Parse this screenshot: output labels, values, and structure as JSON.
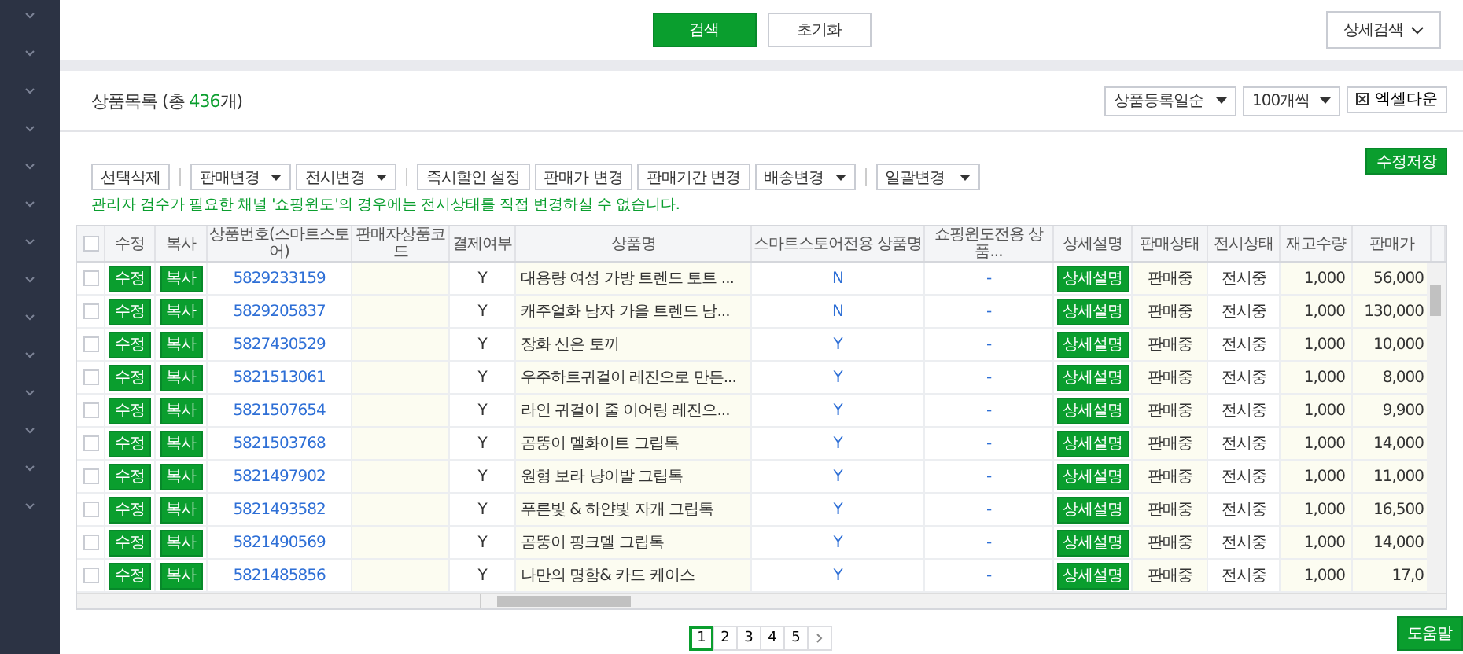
{
  "search_bar": {
    "search": "검색",
    "reset": "초기화",
    "detail_search": "상세검색"
  },
  "list": {
    "title": "상품목록 (총 ",
    "count": "436",
    "title_end": "개)",
    "sort": "상품등록일순",
    "page_size": "100개씩",
    "excel": "엑셀다운"
  },
  "toolbar": {
    "groups": [
      [
        {
          "kind": "button",
          "label": "선택삭제"
        }
      ],
      [
        {
          "kind": "dropdown",
          "label": "판매변경"
        },
        {
          "kind": "dropdown",
          "label": "전시변경"
        }
      ],
      [
        {
          "kind": "button",
          "label": "즉시할인 설정"
        },
        {
          "kind": "button",
          "label": "판매가 변경"
        },
        {
          "kind": "button",
          "label": "판매기간 변경"
        },
        {
          "kind": "dropdown",
          "label": "배송변경"
        }
      ],
      [
        {
          "kind": "wide_dropdown",
          "label": "일괄변경"
        }
      ]
    ],
    "save": "수정저장",
    "notice": "관리자 검수가 필요한 채널 '쇼핑윈도'의 경우에는 전시상태를 직접 변경하실 수 없습니다."
  },
  "table": {
    "all_checked": false,
    "columns": [
      "수정",
      "복사",
      "상품번호(스마트스토어)",
      "판매자상품코드",
      "결제여부",
      "상품명",
      "스마트스토어전용 상품명",
      "쇼핑윈도전용 상품...",
      "상세설명",
      "판매상태",
      "전시상태",
      "재고수량",
      "판매가"
    ],
    "rows": [
      {
        "checked": false,
        "edit": "수정",
        "copy": "복사",
        "product_no": "5829233159",
        "payment": "Y",
        "name": "대용량 여성 가방 트렌드 토트 ...",
        "smartstore_name": "N",
        "window_name": "-",
        "detail": "상세설명",
        "sale_status": "판매중",
        "display_status": "전시중",
        "stock": "1,000",
        "price": "56,000"
      },
      {
        "checked": false,
        "edit": "수정",
        "copy": "복사",
        "product_no": "5829205837",
        "payment": "Y",
        "name": "캐주얼화 남자 가을 트렌드 남...",
        "smartstore_name": "N",
        "window_name": "-",
        "detail": "상세설명",
        "sale_status": "판매중",
        "display_status": "전시중",
        "stock": "1,000",
        "price": "130,000"
      },
      {
        "checked": false,
        "edit": "수정",
        "copy": "복사",
        "product_no": "5827430529",
        "payment": "Y",
        "name": "장화 신은 토끼",
        "smartstore_name": "Y",
        "window_name": "-",
        "detail": "상세설명",
        "sale_status": "판매중",
        "display_status": "전시중",
        "stock": "1,000",
        "price": "10,000"
      },
      {
        "checked": false,
        "edit": "수정",
        "copy": "복사",
        "product_no": "5821513061",
        "payment": "Y",
        "name": "우주하트귀걸이 레진으로 만든...",
        "smartstore_name": "Y",
        "window_name": "-",
        "detail": "상세설명",
        "sale_status": "판매중",
        "display_status": "전시중",
        "stock": "1,000",
        "price": "8,000"
      },
      {
        "checked": false,
        "edit": "수정",
        "copy": "복사",
        "product_no": "5821507654",
        "payment": "Y",
        "name": "라인 귀걸이 줄 이어링 레진으...",
        "smartstore_name": "Y",
        "window_name": "-",
        "detail": "상세설명",
        "sale_status": "판매중",
        "display_status": "전시중",
        "stock": "1,000",
        "price": "9,900"
      },
      {
        "checked": false,
        "edit": "수정",
        "copy": "복사",
        "product_no": "5821503768",
        "payment": "Y",
        "name": "곰뚱이 멜화이트 그립톡",
        "smartstore_name": "Y",
        "window_name": "-",
        "detail": "상세설명",
        "sale_status": "판매중",
        "display_status": "전시중",
        "stock": "1,000",
        "price": "14,000"
      },
      {
        "checked": false,
        "edit": "수정",
        "copy": "복사",
        "product_no": "5821497902",
        "payment": "Y",
        "name": "원형 보라 냥이발 그립톡",
        "smartstore_name": "Y",
        "window_name": "-",
        "detail": "상세설명",
        "sale_status": "판매중",
        "display_status": "전시중",
        "stock": "1,000",
        "price": "11,000"
      },
      {
        "checked": false,
        "edit": "수정",
        "copy": "복사",
        "product_no": "5821493582",
        "payment": "Y",
        "name": "푸른빛 & 하얀빛 자개 그립톡",
        "smartstore_name": "Y",
        "window_name": "-",
        "detail": "상세설명",
        "sale_status": "판매중",
        "display_status": "전시중",
        "stock": "1,000",
        "price": "16,500"
      },
      {
        "checked": false,
        "edit": "수정",
        "copy": "복사",
        "product_no": "5821490569",
        "payment": "Y",
        "name": "곰뚱이 핑크멜 그립톡",
        "smartstore_name": "Y",
        "window_name": "-",
        "detail": "상세설명",
        "sale_status": "판매중",
        "display_status": "전시중",
        "stock": "1,000",
        "price": "14,000"
      },
      {
        "checked": false,
        "edit": "수정",
        "copy": "복사",
        "product_no": "5821485856",
        "payment": "Y",
        "name": "나만의 명함& 카드 케이스",
        "smartstore_name": "Y",
        "window_name": "-",
        "detail": "상세설명",
        "sale_status": "판매중",
        "display_status": "전시중",
        "stock": "1,000",
        "price": "17,0"
      }
    ]
  },
  "pagination": [
    {
      "label": "1",
      "selected": true
    },
    {
      "label": "2",
      "selected": false
    },
    {
      "label": "3",
      "selected": false
    },
    {
      "label": "4",
      "selected": false
    },
    {
      "label": "5",
      "selected": false
    }
  ],
  "help": "도움말"
}
